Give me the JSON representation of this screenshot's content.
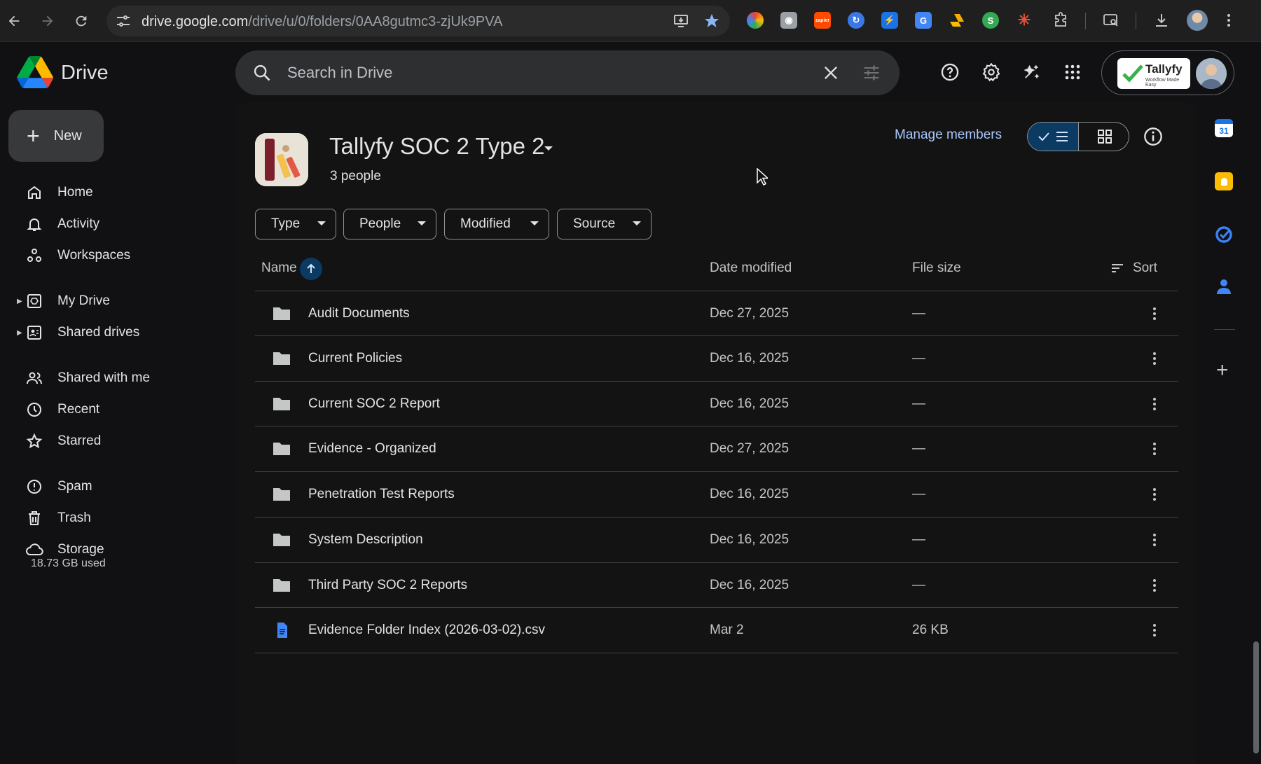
{
  "browser": {
    "url_host": "drive.google.com",
    "url_path": "/drive/u/0/folders/0AA8gutmc3-zjUk9PVA",
    "extensions": [
      {
        "name": "color-picker-icon",
        "color": "#e8a33a",
        "label": ""
      },
      {
        "name": "camera-icon",
        "color": "#9aa0a6",
        "label": ""
      },
      {
        "name": "zapier-icon",
        "color": "#ff4a00",
        "label": "zapier"
      },
      {
        "name": "sync-icon",
        "color": "#3b78e7",
        "label": ""
      },
      {
        "name": "bolt-icon",
        "color": "#1a73e8",
        "label": ""
      },
      {
        "name": "translate-icon",
        "color": "#4285f4",
        "label": ""
      },
      {
        "name": "drive-extension-icon",
        "color": "#f9ab00",
        "label": ""
      },
      {
        "name": "s-extension-icon",
        "color": "#34a853",
        "label": "S"
      },
      {
        "name": "sparkle-icon",
        "color": "#e8543a",
        "label": ""
      }
    ]
  },
  "brand": {
    "name": "Drive"
  },
  "sidebar": {
    "new_label": "New",
    "items": [
      {
        "label": "Home",
        "icon": "home-icon"
      },
      {
        "label": "Activity",
        "icon": "bell-icon"
      },
      {
        "label": "Workspaces",
        "icon": "workspaces-icon"
      },
      {
        "label": "My Drive",
        "icon": "my-drive-icon"
      },
      {
        "label": "Shared drives",
        "icon": "shared-drives-icon"
      },
      {
        "label": "Shared with me",
        "icon": "people-icon"
      },
      {
        "label": "Recent",
        "icon": "clock-icon"
      },
      {
        "label": "Starred",
        "icon": "star-icon"
      },
      {
        "label": "Spam",
        "icon": "spam-icon"
      },
      {
        "label": "Trash",
        "icon": "trash-icon"
      },
      {
        "label": "Storage",
        "icon": "cloud-icon"
      }
    ],
    "storage_used": "18.73 GB used"
  },
  "search": {
    "placeholder": "Search in Drive"
  },
  "account": {
    "org_name": "Tallyfy",
    "org_tagline": "Workflow Made Easy"
  },
  "folder": {
    "title": "Tallyfy SOC 2 Type 2",
    "members": "3 people",
    "manage_label": "Manage members"
  },
  "filters": [
    "Type",
    "People",
    "Modified",
    "Source"
  ],
  "table": {
    "columns": {
      "name": "Name",
      "date": "Date modified",
      "size": "File size",
      "sort": "Sort"
    },
    "rows": [
      {
        "name": "Audit Documents",
        "type": "folder",
        "date": "Dec 27, 2025",
        "size": "—"
      },
      {
        "name": "Current Policies",
        "type": "folder",
        "date": "Dec 16, 2025",
        "size": "—"
      },
      {
        "name": "Current SOC 2 Report",
        "type": "folder",
        "date": "Dec 16, 2025",
        "size": "—"
      },
      {
        "name": "Evidence - Organized",
        "type": "folder",
        "date": "Dec 27, 2025",
        "size": "—"
      },
      {
        "name": "Penetration Test Reports",
        "type": "folder",
        "date": "Dec 16, 2025",
        "size": "—"
      },
      {
        "name": "System Description",
        "type": "folder",
        "date": "Dec 16, 2025",
        "size": "—"
      },
      {
        "name": "Third Party SOC 2 Reports",
        "type": "folder",
        "date": "Dec 16, 2025",
        "size": "—"
      },
      {
        "name": "Evidence Folder Index (2026-03-02).csv",
        "type": "doc",
        "date": "Mar 2",
        "size": "26 KB"
      }
    ]
  },
  "right_rail": {
    "calendar_day": "31",
    "apps": [
      "calendar-icon",
      "keep-icon",
      "tasks-icon",
      "contacts-icon"
    ]
  },
  "colors": {
    "accent_blue": "#a8c7fa",
    "selected_toggle": "#0b3a63",
    "folder_gray": "#c4c7c5",
    "doc_blue": "#4285f4"
  }
}
